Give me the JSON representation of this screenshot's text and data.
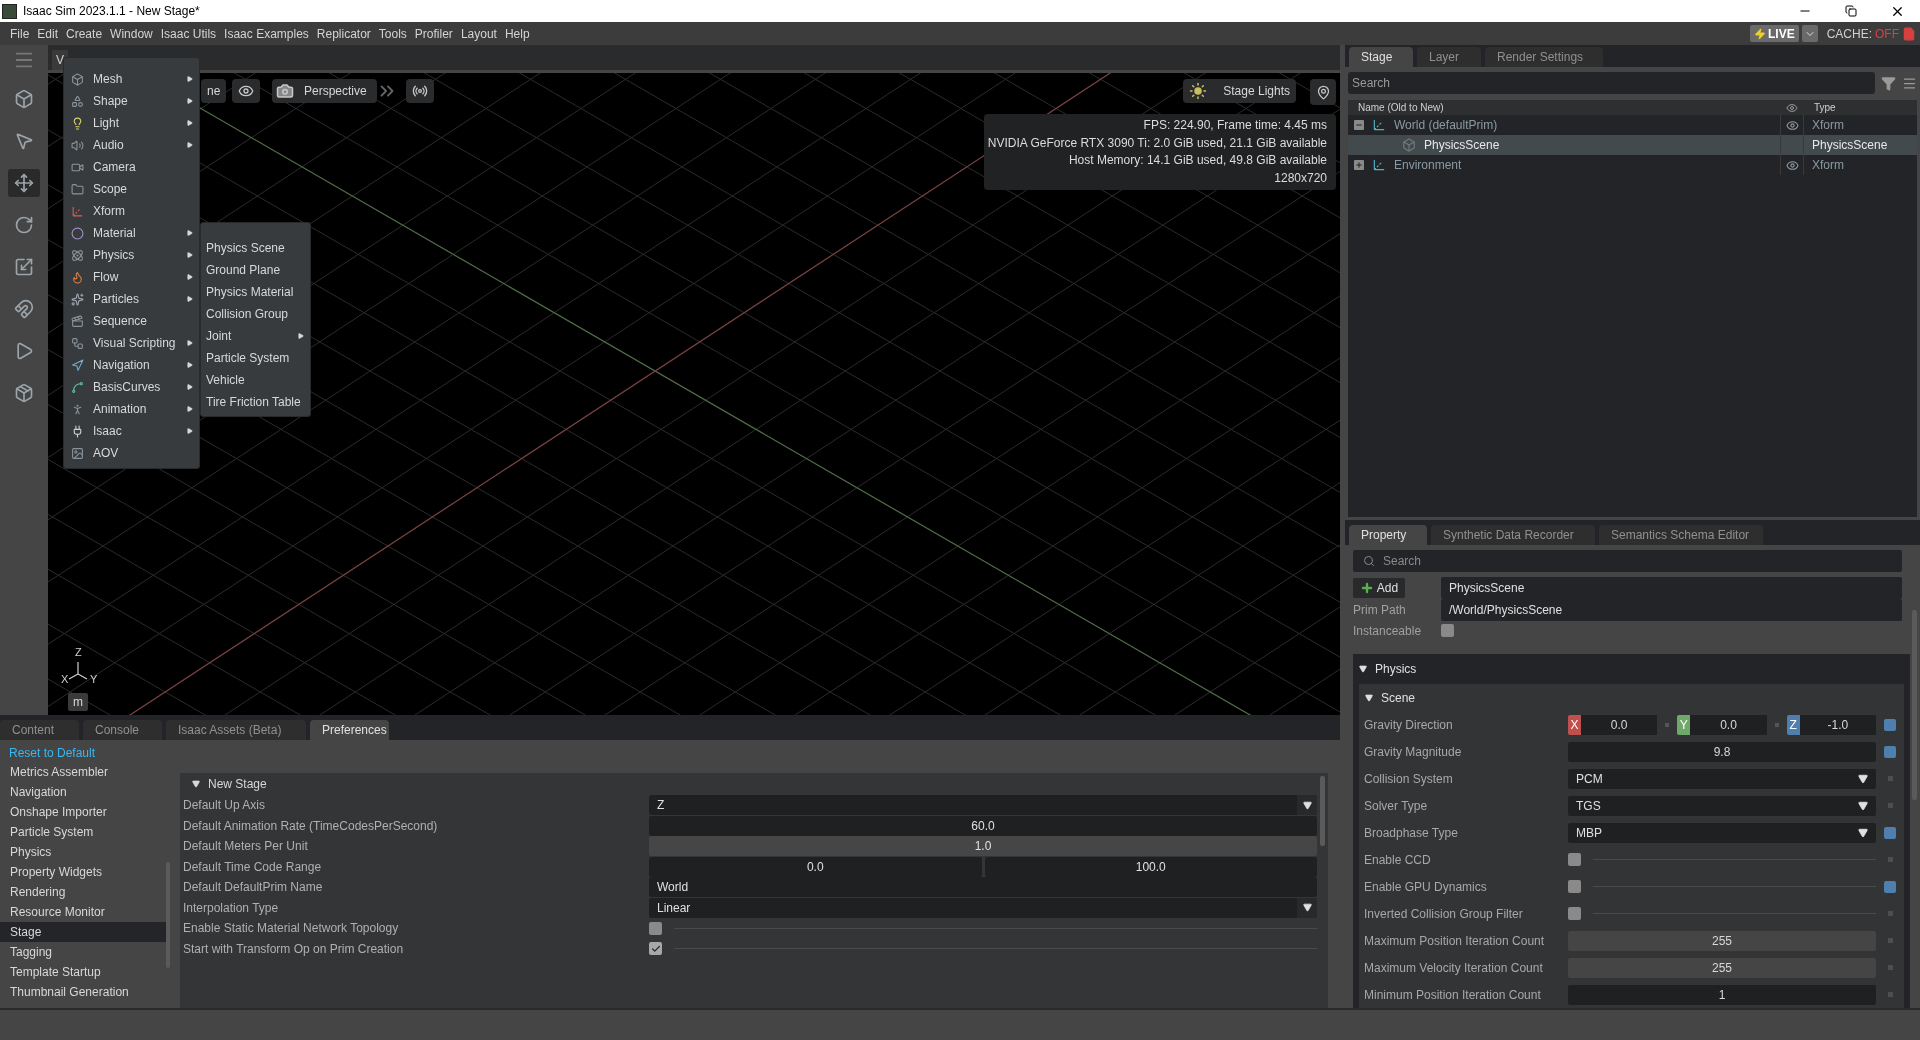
{
  "window": {
    "title": "Isaac Sim 2023.1.1 - New Stage*"
  },
  "menu_bar": {
    "items": [
      "File",
      "Edit",
      "Create",
      "Window",
      "Isaac Utils",
      "Isaac Examples",
      "Replicator",
      "Tools",
      "Profiler",
      "Layout",
      "Help"
    ],
    "live": "LIVE",
    "cache_label": "CACHE:",
    "cache_value": "OFF"
  },
  "viewport": {
    "tab_label": "V",
    "partial_button": "ne",
    "camera_button": "Perspective",
    "lights_button": "Stage Lights",
    "stats": [
      "FPS: 224.90, Frame time: 4.45 ms",
      "NVIDIA GeForce RTX 3090 Ti: 2.0 GiB used, 21.1 GiB available",
      "Host Memory: 14.1 GiB used, 49.8 GiB available",
      "1280x720"
    ],
    "axes": {
      "z": "Z",
      "x": "X",
      "y": "Y"
    },
    "units_button": "m"
  },
  "create_menu": {
    "items": [
      {
        "label": "Mesh",
        "submenu": true
      },
      {
        "label": "Shape",
        "submenu": true
      },
      {
        "label": "Light",
        "submenu": true
      },
      {
        "label": "Audio",
        "submenu": true
      },
      {
        "label": "Camera",
        "submenu": false
      },
      {
        "label": "Scope",
        "submenu": false
      },
      {
        "label": "Xform",
        "submenu": false
      },
      {
        "label": "Material",
        "submenu": true
      },
      {
        "label": "Physics",
        "submenu": true
      },
      {
        "label": "Flow",
        "submenu": true
      },
      {
        "label": "Particles",
        "submenu": true
      },
      {
        "label": "Sequence",
        "submenu": false
      },
      {
        "label": "Visual Scripting",
        "submenu": true
      },
      {
        "label": "Navigation",
        "submenu": true
      },
      {
        "label": "BasisCurves",
        "submenu": true
      },
      {
        "label": "Animation",
        "submenu": true
      },
      {
        "label": "Isaac",
        "submenu": true
      },
      {
        "label": "AOV",
        "submenu": false
      }
    ]
  },
  "physics_submenu": {
    "items": [
      {
        "label": "Physics Scene",
        "submenu": false
      },
      {
        "label": "Ground Plane",
        "submenu": false
      },
      {
        "label": "Physics Material",
        "submenu": false
      },
      {
        "label": "Collision Group",
        "submenu": false
      },
      {
        "label": "Joint",
        "submenu": true
      },
      {
        "label": "Particle System",
        "submenu": false
      },
      {
        "label": "Vehicle",
        "submenu": false
      },
      {
        "label": "Tire Friction Table",
        "submenu": false
      }
    ]
  },
  "stage_panel": {
    "tabs": [
      {
        "label": "Stage",
        "selected": true
      },
      {
        "label": "Layer",
        "selected": false
      },
      {
        "label": "Render Settings",
        "selected": false
      }
    ],
    "search": {
      "placeholder": "Search"
    },
    "columns": {
      "name": "Name (Old to New)",
      "type": "Type"
    },
    "rows": [
      {
        "name": "World (defaultPrim)",
        "type": "Xform",
        "visible": true,
        "selected": false,
        "expanded": true,
        "children": [
          {
            "name": "PhysicsScene",
            "type": "PhysicsScene",
            "visible": false,
            "selected": true
          }
        ]
      },
      {
        "name": "Environment",
        "type": "Xform",
        "visible": true,
        "selected": false,
        "expanded": false
      }
    ]
  },
  "property_panel": {
    "tabs": [
      {
        "label": "Property",
        "selected": true
      },
      {
        "label": "Synthetic Data Recorder",
        "selected": false
      },
      {
        "label": "Semantics Schema Editor",
        "selected": false
      }
    ],
    "search": {
      "placeholder": "Search"
    },
    "add_button": "Add",
    "prim_name": "PhysicsScene",
    "prim_path_label": "Prim Path",
    "prim_path": "/World/PhysicsScene",
    "instanceable_label": "Instanceable",
    "instanceable": false,
    "section": {
      "title": "Physics",
      "expanded": true
    },
    "subsection": {
      "title": "Scene",
      "expanded": true
    },
    "rows": [
      {
        "kind": "vector",
        "label": "Gravity Direction",
        "modified": true,
        "components": [
          {
            "axis": "X",
            "value": "0.0",
            "color": "#c0504d"
          },
          {
            "axis": "Y",
            "value": "0.0",
            "color": "#6fa86a"
          },
          {
            "axis": "Z",
            "value": "-1.0",
            "color": "#4f7fae"
          }
        ]
      },
      {
        "kind": "number",
        "label": "Gravity Magnitude",
        "value": "9.8",
        "modified": true,
        "disabled": false
      },
      {
        "kind": "dropdown",
        "label": "Collision System",
        "value": "PCM",
        "modified": false
      },
      {
        "kind": "dropdown",
        "label": "Solver Type",
        "value": "TGS",
        "modified": false
      },
      {
        "kind": "dropdown",
        "label": "Broadphase Type",
        "value": "MBP",
        "modified": true
      },
      {
        "kind": "checkbox",
        "label": "Enable CCD",
        "checked": false,
        "modified": false
      },
      {
        "kind": "checkbox",
        "label": "Enable GPU Dynamics",
        "checked": false,
        "modified": true
      },
      {
        "kind": "checkbox",
        "label": "Inverted Collision Group Filter",
        "checked": false,
        "modified": false
      },
      {
        "kind": "number",
        "label": "Maximum Position Iteration Count",
        "value": "255",
        "modified": false,
        "disabled": true
      },
      {
        "kind": "number",
        "label": "Maximum Velocity Iteration Count",
        "value": "255",
        "modified": false,
        "disabled": true
      },
      {
        "kind": "number",
        "label": "Minimum Position Iteration Count",
        "value": "1",
        "modified": false,
        "disabled": false
      }
    ]
  },
  "bottom_panel": {
    "tabs": [
      {
        "label": "Content",
        "selected": false
      },
      {
        "label": "Console",
        "selected": false
      },
      {
        "label": "Isaac Assets (Beta)",
        "selected": false
      },
      {
        "label": "Preferences",
        "selected": true
      }
    ],
    "reset_link": "Reset to Default",
    "categories": [
      {
        "label": "Metrics Assembler",
        "selected": false
      },
      {
        "label": "Navigation",
        "selected": false
      },
      {
        "label": "Onshape Importer",
        "selected": false
      },
      {
        "label": "Particle System",
        "selected": false
      },
      {
        "label": "Physics",
        "selected": false
      },
      {
        "label": "Property Widgets",
        "selected": false
      },
      {
        "label": "Rendering",
        "selected": false
      },
      {
        "label": "Resource Monitor",
        "selected": false
      },
      {
        "label": "Stage",
        "selected": true
      },
      {
        "label": "Tagging",
        "selected": false
      },
      {
        "label": "Template Startup",
        "selected": false
      },
      {
        "label": "Thumbnail Generation",
        "selected": false
      }
    ],
    "section": {
      "title": "New Stage",
      "expanded": true
    },
    "rows": [
      {
        "kind": "dropdown",
        "label": "Default Up Axis",
        "value": "Z"
      },
      {
        "kind": "number",
        "label": "Default Animation Rate (TimeCodesPerSecond)",
        "value": "60.0",
        "disabled": false
      },
      {
        "kind": "number",
        "label": "Default Meters Per Unit",
        "value": "1.0",
        "disabled": true
      },
      {
        "kind": "range",
        "label": "Default Time Code Range",
        "values": [
          "0.0",
          "100.0"
        ]
      },
      {
        "kind": "text",
        "label": "Default DefaultPrim Name",
        "value": "World"
      },
      {
        "kind": "dropdown",
        "label": "Interpolation Type",
        "value": "Linear"
      },
      {
        "kind": "checkbox",
        "label": "Enable Static Material Network Topology",
        "checked": false
      },
      {
        "kind": "checkbox",
        "label": "Start with Transform Op on Prim Creation",
        "checked": true
      }
    ]
  }
}
